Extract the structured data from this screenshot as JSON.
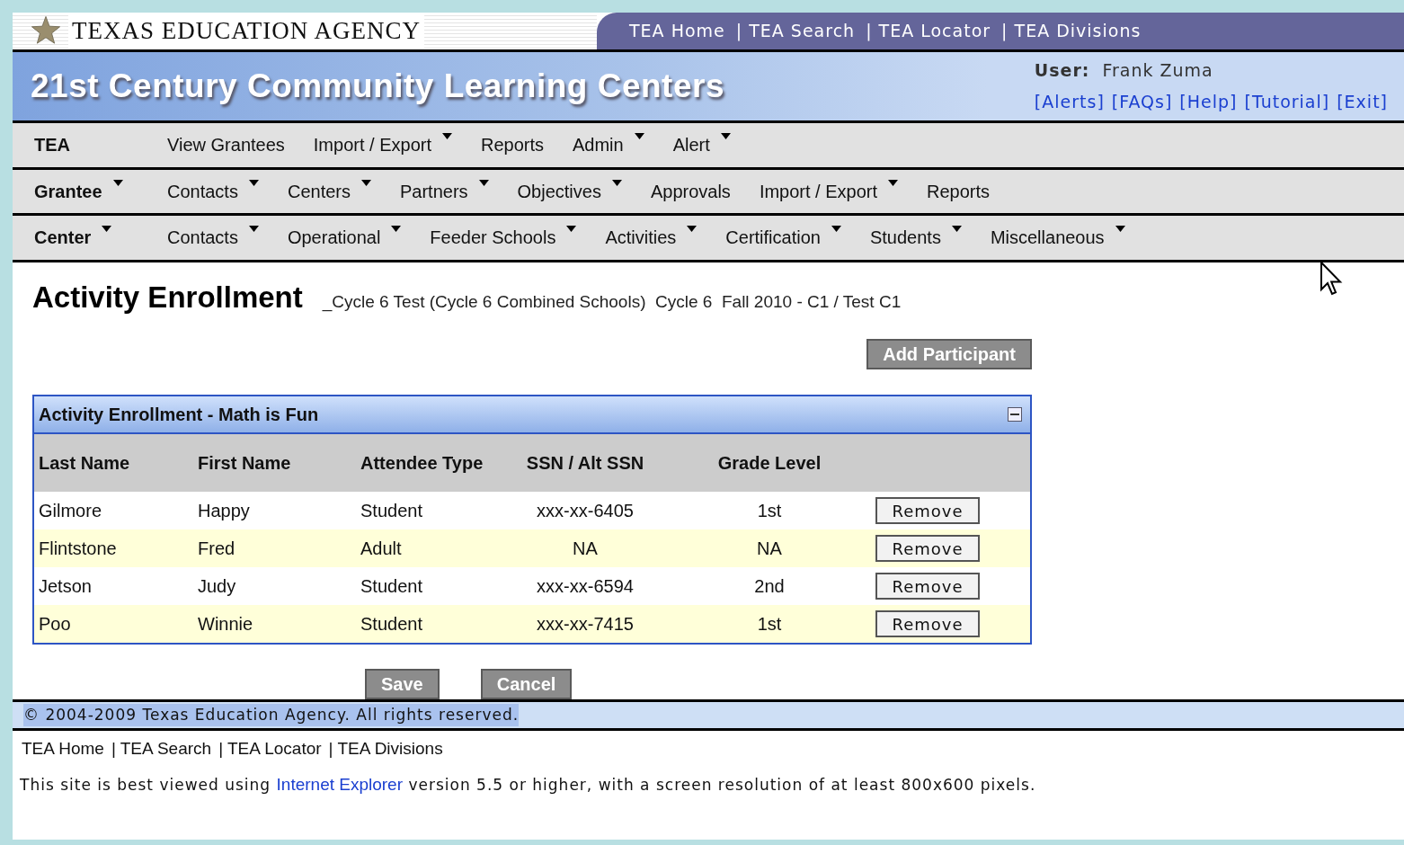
{
  "header": {
    "agency": "TEXAS EDUCATION AGENCY",
    "top_links": [
      {
        "label": "TEA Home"
      },
      {
        "label": "| TEA Search"
      },
      {
        "label": "| TEA Locator"
      },
      {
        "label": "| TEA Divisions"
      }
    ],
    "app_title": "21st Century Community Learning Centers",
    "user_label": "User:",
    "user_name": "Frank Zuma",
    "user_links": [
      {
        "label": "[Alerts]"
      },
      {
        "label": "[FAQs]"
      },
      {
        "label": "[Help]"
      },
      {
        "label": "[Tutorial]"
      },
      {
        "label": "[Exit]"
      }
    ]
  },
  "menus": [
    {
      "title": "TEA",
      "title_dropdown": false,
      "items": [
        {
          "label": "View Grantees",
          "dropdown": false
        },
        {
          "label": "Import / Export",
          "dropdown": true
        },
        {
          "label": "Reports",
          "dropdown": false
        },
        {
          "label": "Admin",
          "dropdown": true
        },
        {
          "label": "Alert",
          "dropdown": true
        }
      ]
    },
    {
      "title": "Grantee",
      "title_dropdown": true,
      "items": [
        {
          "label": "Contacts",
          "dropdown": true
        },
        {
          "label": "Centers",
          "dropdown": true
        },
        {
          "label": "Partners",
          "dropdown": true
        },
        {
          "label": "Objectives",
          "dropdown": true
        },
        {
          "label": "Approvals",
          "dropdown": false
        },
        {
          "label": "Import / Export",
          "dropdown": true
        },
        {
          "label": "Reports",
          "dropdown": false
        }
      ]
    },
    {
      "title": "Center",
      "title_dropdown": true,
      "items": [
        {
          "label": "Contacts",
          "dropdown": true
        },
        {
          "label": "Operational",
          "dropdown": true
        },
        {
          "label": "Feeder Schools",
          "dropdown": true
        },
        {
          "label": "Activities",
          "dropdown": true
        },
        {
          "label": "Certification",
          "dropdown": true
        },
        {
          "label": "Students",
          "dropdown": true
        },
        {
          "label": "Miscellaneous",
          "dropdown": true
        }
      ]
    }
  ],
  "page": {
    "title": "Activity Enrollment",
    "subtitle": "_Cycle 6 Test (Cycle 6 Combined Schools)  Cycle 6  Fall 2010 - C1 / Test C1",
    "add_button": "Add Participant"
  },
  "panel": {
    "title": "Activity Enrollment - Math is Fun",
    "columns": [
      "Last Name",
      "First Name",
      "Attendee Type",
      "SSN / Alt SSN",
      "Grade Level"
    ],
    "rows": [
      {
        "last": "Gilmore",
        "first": "Happy",
        "type": "Student",
        "ssn": "xxx-xx-6405",
        "grade": "1st",
        "action": "Remove"
      },
      {
        "last": "Flintstone",
        "first": "Fred",
        "type": "Adult",
        "ssn": "NA",
        "grade": "NA",
        "action": "Remove"
      },
      {
        "last": "Jetson",
        "first": "Judy",
        "type": "Student",
        "ssn": "xxx-xx-6594",
        "grade": "2nd",
        "action": "Remove"
      },
      {
        "last": "Poo",
        "first": "Winnie",
        "type": "Student",
        "ssn": "xxx-xx-7415",
        "grade": "1st",
        "action": "Remove"
      }
    ]
  },
  "form_buttons": [
    "Save",
    "Cancel"
  ],
  "footer": {
    "copyright": "© 2004-2009 Texas Education Agency. All rights reserved.",
    "links": [
      {
        "label": "TEA Home"
      },
      {
        "label": "| TEA Search"
      },
      {
        "label": "| TEA Locator"
      },
      {
        "label": "| TEA Divisions"
      }
    ],
    "note_before": "This site is best viewed using",
    "note_link": "Internet Explorer",
    "note_after": "version 5.5 or higher, with a screen resolution of at least 800x600 pixels."
  }
}
